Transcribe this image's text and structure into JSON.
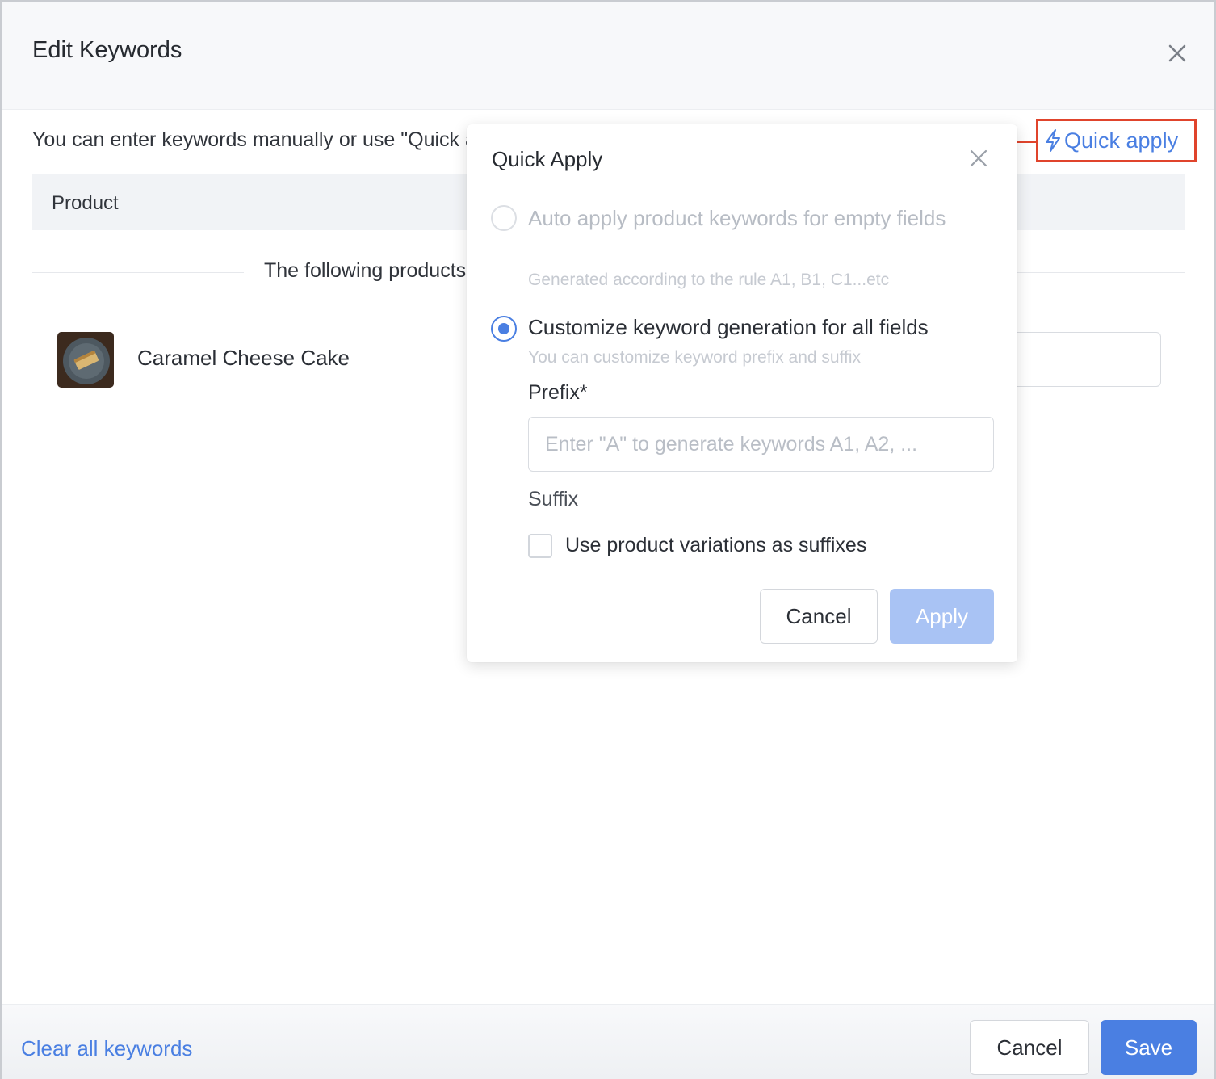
{
  "dialog": {
    "title": "Edit Keywords",
    "hint": "You can enter keywords manually or use \"Quick apply\"",
    "quick_apply_label": "Quick apply",
    "table_header_product": "Product",
    "following_text": "The following products",
    "product": {
      "name": "Caramel Cheese Cake"
    },
    "footer": {
      "clear_label": "Clear all keywords",
      "cancel_label": "Cancel",
      "save_label": "Save"
    }
  },
  "popover": {
    "title": "Quick Apply",
    "option_auto": {
      "label": "Auto apply product keywords for empty fields",
      "sub": "Generated according to the rule A1, B1, C1...etc",
      "selected": false
    },
    "option_custom": {
      "label": "Customize keyword generation for all fields",
      "sub": "You can customize keyword prefix and suffix",
      "selected": true
    },
    "prefix_label": "Prefix*",
    "prefix_value": "",
    "prefix_placeholder": "Enter \"A\" to generate keywords A1, A2, ...",
    "suffix_label": "Suffix",
    "suffix_checkbox_label": "Use product variations as suffixes",
    "suffix_checked": false,
    "cancel_label": "Cancel",
    "apply_label": "Apply"
  },
  "colors": {
    "accent": "#4a7fe2",
    "accent_disabled": "#a9c3f4",
    "callout": "#e0442c"
  },
  "icons": [
    "close-icon",
    "lightning-icon",
    "product-thumbnail"
  ]
}
